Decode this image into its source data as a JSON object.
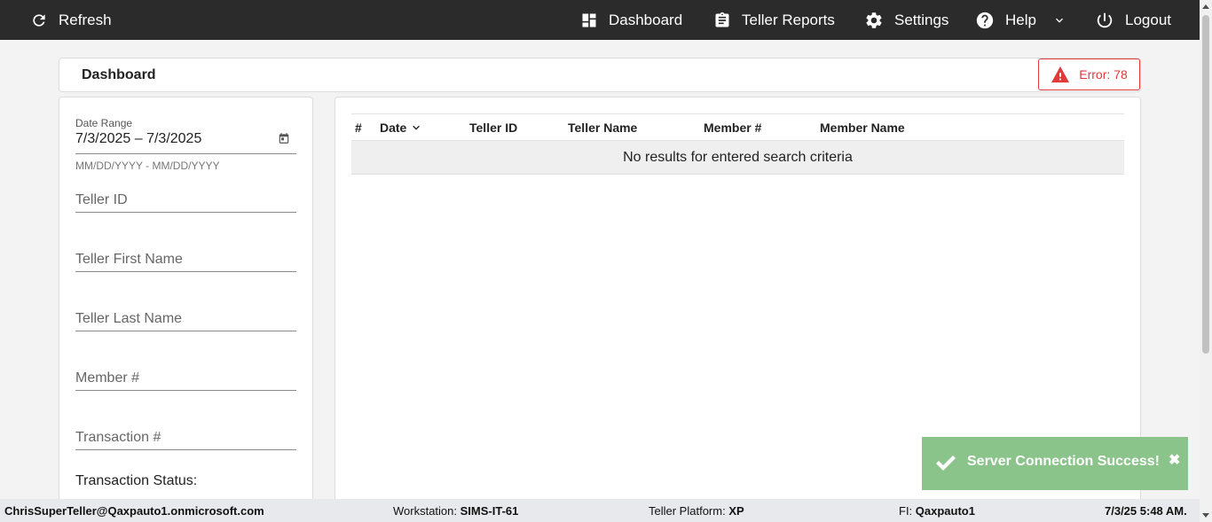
{
  "nav": {
    "refresh_label": "Refresh",
    "dashboard_label": "Dashboard",
    "reports_label": "Teller Reports",
    "settings_label": "Settings",
    "help_label": "Help",
    "logout_label": "Logout"
  },
  "header": {
    "title": "Dashboard",
    "error_label": "Error: 78",
    "error_color": "#e03a3a"
  },
  "filters": {
    "date_range_label": "Date Range",
    "date_range_value": "7/3/2025 – 7/3/2025",
    "date_range_hint": "MM/DD/YYYY - MM/DD/YYYY",
    "teller_id_placeholder": "Teller ID",
    "teller_first_name_placeholder": "Teller First Name",
    "teller_last_name_placeholder": "Teller Last Name",
    "member_num_placeholder": "Member #",
    "transaction_num_placeholder": "Transaction #",
    "transaction_status_label": "Transaction Status:"
  },
  "table": {
    "columns": [
      "#",
      "Date",
      "Teller ID",
      "Teller Name",
      "Member #",
      "Member Name"
    ],
    "empty_message": "No results for entered search criteria"
  },
  "toast": {
    "message": "Server Connection Success!",
    "close_glyph": "✖",
    "color": "#8bc48a"
  },
  "footer": {
    "user": "ChrisSuperTeller@Qaxpauto1.onmicrosoft.com",
    "workstation_label": "Workstation:",
    "workstation_value": "SIMS-IT-61",
    "platform_label": "Teller Platform:",
    "platform_value": "XP",
    "fi_label": "FI:",
    "fi_value": "Qaxpauto1",
    "datetime": "7/3/25 5:48 AM."
  }
}
